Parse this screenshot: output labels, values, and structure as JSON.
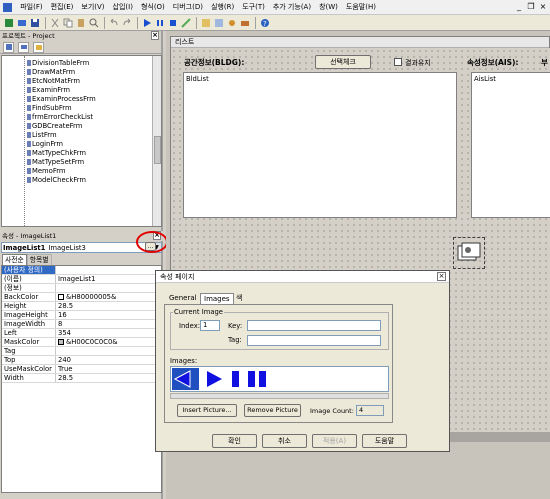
{
  "menu": {
    "items": [
      "파일(F)",
      "편집(E)",
      "보기(V)",
      "삽입(I)",
      "형식(O)",
      "디버그(D)",
      "실행(R)",
      "도구(T)",
      "추가 기능(A)",
      "창(W)",
      "도움말(H)"
    ],
    "window_controls": {
      "minimize": "_",
      "restore": "❐",
      "close": "×"
    }
  },
  "project_panel": {
    "title": "프로젝트 - Project",
    "items": [
      "DivisionTableFrm",
      "DrawMatFrm",
      "EtcNotMatFrm",
      "ExaminFrm",
      "ExaminProcessFrm",
      "FindSubFrm",
      "frmErrorCheckList",
      "GDBCreateFrm",
      "ListFrm",
      "LoginFrm",
      "MatTypeChkFrm",
      "MatTypeSetFrm",
      "MemoFrm",
      "ModelCheckFrm"
    ]
  },
  "properties_panel": {
    "title": "속성 - ImageList1",
    "object_name": "ImageList1",
    "object_type": "ImageList3",
    "tabs": [
      "사전순",
      "항목별"
    ],
    "rows": [
      {
        "name": "(사용자 정의)",
        "value": "",
        "selected": true
      },
      {
        "name": "(이름)",
        "value": "ImageList1"
      },
      {
        "name": "(정보)",
        "value": ""
      },
      {
        "name": "BackColor",
        "value": "&H80000005&",
        "swatch": "#ffffff"
      },
      {
        "name": "Height",
        "value": "28.5"
      },
      {
        "name": "ImageHeight",
        "value": "16"
      },
      {
        "name": "ImageWidth",
        "value": "8"
      },
      {
        "name": "Left",
        "value": "354"
      },
      {
        "name": "MaskColor",
        "value": "&H00C0C0C0&",
        "swatch": "#c0c0c0"
      },
      {
        "name": "Tag",
        "value": ""
      },
      {
        "name": "Top",
        "value": "240"
      },
      {
        "name": "UseMaskColor",
        "value": "True"
      },
      {
        "name": "Width",
        "value": "28.5"
      }
    ],
    "ellipsis": "..."
  },
  "form": {
    "title": "리스트",
    "label_bldg": "공간정보(BLDG):",
    "btn_select_check": "선택체크",
    "checkbox_keep_result": "결과유지",
    "label_ais": "속성정보(AIS):",
    "label_extra": "부",
    "list_bldg": "BldList",
    "list_ais": "AisList"
  },
  "dialog": {
    "title": "속성 페이지",
    "tabs": [
      "General",
      "Images",
      "색"
    ],
    "active_tab": "Images",
    "group_current_image": "Current Image",
    "label_index": "Index:",
    "index_value": "1",
    "label_key": "Key:",
    "label_tag": "Tag:",
    "label_images": "Images:",
    "btn_insert": "Insert Picture...",
    "btn_remove": "Remove Picture",
    "label_image_count": "Image Count:",
    "image_count": "4",
    "btn_ok": "확인",
    "btn_cancel": "취소",
    "btn_apply": "적용(A)",
    "btn_help": "도움말"
  },
  "colors": {
    "highlight": "#316ac5",
    "image_blue": "#1010e0",
    "annotation_red": "#e00000"
  }
}
